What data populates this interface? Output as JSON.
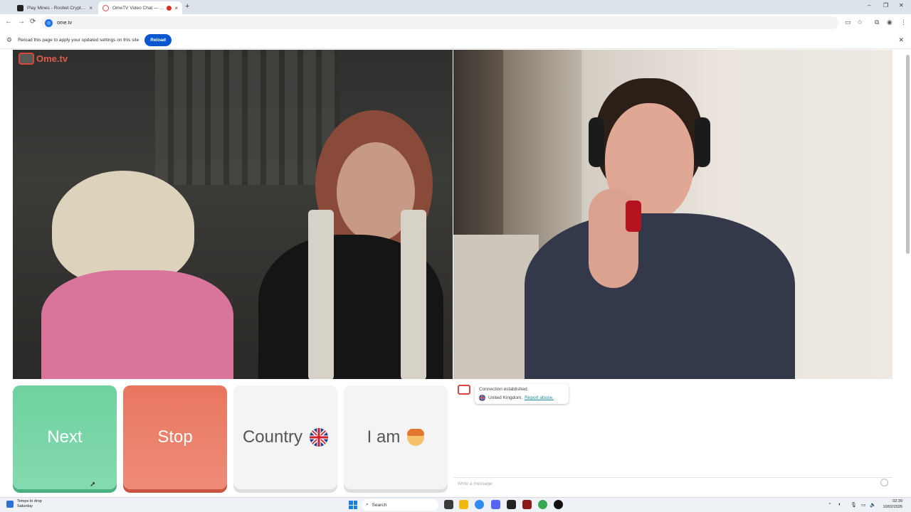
{
  "browser": {
    "tabs": [
      {
        "title": "Play Mines - Roobet Crypto Ca",
        "state": "inactive"
      },
      {
        "title": "OmeTV Video Chat — Ome",
        "state": "active",
        "recording": true
      }
    ],
    "new_tab_symbol": "+",
    "tab_close_symbol": "×",
    "window_controls": {
      "minimize": "–",
      "restore": "❐",
      "close": "✕"
    },
    "url": "ome.tv",
    "nav": {
      "back": "←",
      "forward": "→",
      "reload": "⟳"
    }
  },
  "infobar": {
    "message": "Reload this page to apply your updated settings on this site",
    "button": "Reload",
    "close": "✕"
  },
  "site": {
    "logo_text": "Ome.tv"
  },
  "controls": {
    "next": "Next",
    "stop": "Stop",
    "country": "Country",
    "iam": "I am"
  },
  "chat": {
    "status": "Connection established.",
    "country": "United Kingdom.",
    "report": "Report abuse.",
    "input_placeholder": "Write a message"
  },
  "taskbar": {
    "weather_line1": "Temps to drop",
    "weather_line2": "Saturday",
    "search": "Search",
    "time": "02:39",
    "date": "10/02/2026"
  },
  "colors": {
    "next": "#6fd1a0",
    "stop": "#e8765f",
    "brand": "#e05a4e",
    "link": "#1f8b99",
    "reload_button": "#0b57d0"
  }
}
